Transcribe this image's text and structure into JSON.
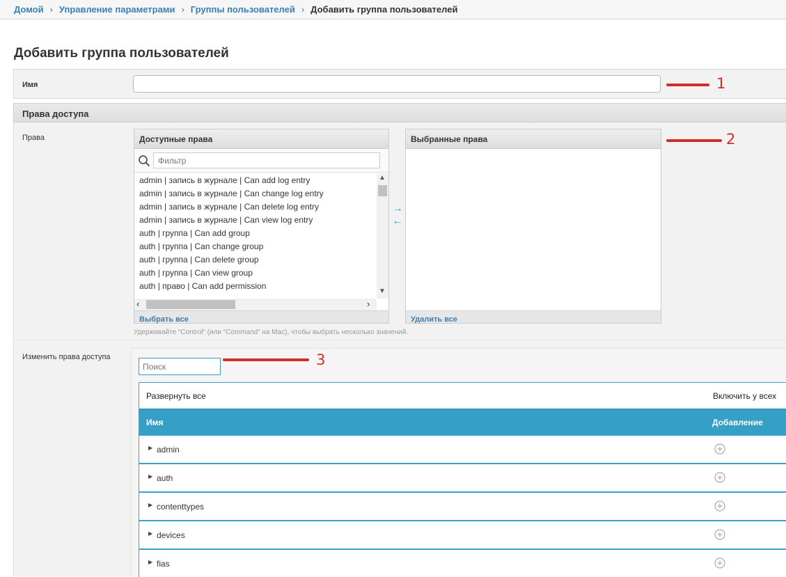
{
  "breadcrumbs": [
    {
      "label": "Домой"
    },
    {
      "label": "Управление параметрами"
    },
    {
      "label": "Группы пользователей"
    },
    {
      "label": "Добавить группа пользователей"
    }
  ],
  "page_title": "Добавить группа пользователей",
  "name_field": {
    "label": "Имя",
    "value": ""
  },
  "access_section": {
    "title": "Права доступа"
  },
  "rights": {
    "label": "Права",
    "available_title": "Доступные права",
    "filter_placeholder": "Фильтр",
    "options": [
      "admin | запись в журнале | Can add log entry",
      "admin | запись в журнале | Can change log entry",
      "admin | запись в журнале | Can delete log entry",
      "admin | запись в журнале | Can view log entry",
      "auth | группа | Can add group",
      "auth | группа | Can change group",
      "auth | группа | Can delete group",
      "auth | группа | Can view group",
      "auth | право | Can add permission"
    ],
    "choose_all": "Выбрать все",
    "chosen_title": "Выбранные права",
    "remove_all": "Удалить все",
    "help_text": "Удерживайте “Control“ (или “Command“ на Mac), чтобы выбрать несколько значений."
  },
  "change_rights": {
    "label": "Изменить права доступа",
    "search_placeholder": "Поиск",
    "expand_all": "Развернуть все",
    "enable_all": "Включить у всех",
    "col_name": "Имя",
    "col_add": "Добавление",
    "rows": [
      {
        "name": "admin"
      },
      {
        "name": "auth"
      },
      {
        "name": "contenttypes"
      },
      {
        "name": "devices"
      },
      {
        "name": "fias"
      }
    ]
  },
  "annotations": [
    "1",
    "2",
    "3"
  ],
  "colors": {
    "accent": "#359fc5",
    "link": "#3a7fb3",
    "annotation": "#d52b2b"
  }
}
